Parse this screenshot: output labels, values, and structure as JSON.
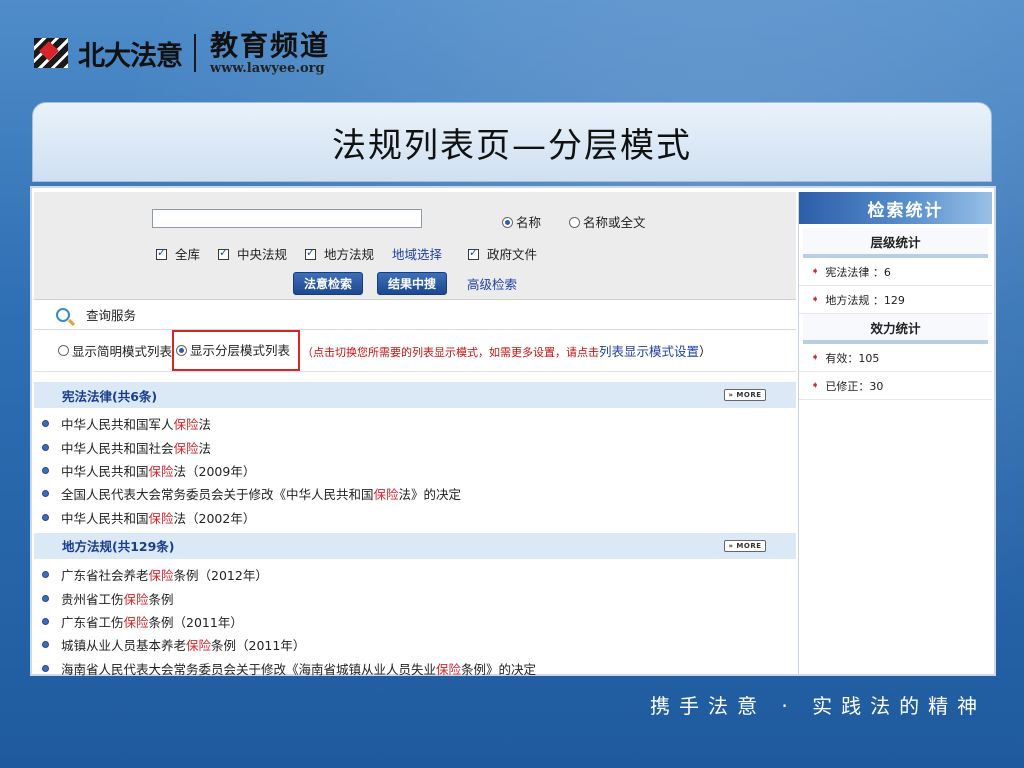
{
  "header": {
    "brand": "北大法意",
    "channel": "教育频道",
    "url": "www.lawyee.org"
  },
  "title": "法规列表页—分层模式",
  "search": {
    "value": "",
    "radio": [
      {
        "label": "名称",
        "checked": true
      },
      {
        "label": "名称或全文",
        "checked": false
      }
    ],
    "checkboxes": [
      {
        "label": "全库",
        "checked": true
      },
      {
        "label": "中央法规",
        "checked": true
      },
      {
        "label": "地方法规",
        "checked": true
      }
    ],
    "region_link": "地域选择",
    "gov_doc": {
      "label": "政府文件",
      "checked": true
    },
    "buttons": {
      "search": "法意检索",
      "refine": "结果中搜"
    },
    "advanced": "高级检索"
  },
  "query_bar": {
    "label": "查询服务"
  },
  "mode": {
    "simple": "显示简明模式列表",
    "layered": "显示分层模式列表",
    "hint_open": "（",
    "hint": "点击切换您所需要的列表显示模式，如需更多设置，请点击",
    "hint_link": "列表显示模式设置",
    "hint_close": "）"
  },
  "sections": [
    {
      "title": "宪法法律(共6条)",
      "more": "» MORE",
      "items": [
        {
          "pre": "中华人民共和国军人",
          "hl": "保险",
          "post": "法"
        },
        {
          "pre": "中华人民共和国社会",
          "hl": "保险",
          "post": "法"
        },
        {
          "pre": "中华人民共和国",
          "hl": "保险",
          "post": "法（2009年）"
        },
        {
          "pre": "全国人民代表大会常务委员会关于修改《中华人民共和国",
          "hl": "保险",
          "post": "法》的决定"
        },
        {
          "pre": "中华人民共和国",
          "hl": "保险",
          "post": "法（2002年）"
        }
      ]
    },
    {
      "title": "地方法规(共129条)",
      "more": "» MORE",
      "items": [
        {
          "pre": "广东省社会养老",
          "hl": "保险",
          "post": "条例（2012年）"
        },
        {
          "pre": "贵州省工伤",
          "hl": "保险",
          "post": "条例"
        },
        {
          "pre": "广东省工伤",
          "hl": "保险",
          "post": "条例（2011年）"
        },
        {
          "pre": "城镇从业人员基本养老",
          "hl": "保险",
          "post": "条例（2011年）"
        },
        {
          "pre": "海南省人民代表大会常务委员会关于修改《海南省城镇从业人员失业",
          "hl": "保险",
          "post": "条例》的决定"
        }
      ]
    }
  ],
  "stats": {
    "title": "检索统计",
    "level_title": "层级统计",
    "level_items": [
      "宪法法律 ：6",
      "地方法规 ：129"
    ],
    "effect_title": "效力统计",
    "effect_items": [
      "有效：105",
      "已修正：30"
    ]
  },
  "slogan": "携手法意 · 实践法的精神"
}
